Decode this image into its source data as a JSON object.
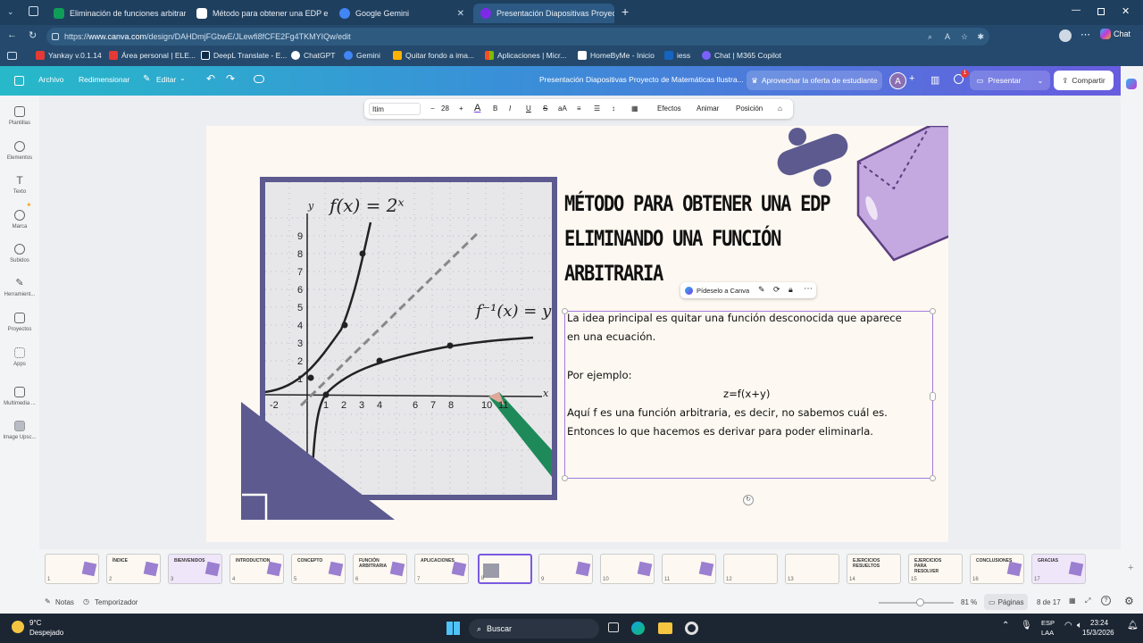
{
  "browser": {
    "tabs": [
      {
        "title": "Eliminación de funciones arbitraria",
        "color": "#0f9d58"
      },
      {
        "title": "Método para obtener una EDP eli",
        "color": "#ffffff"
      },
      {
        "title": "Google Gemini",
        "color": "#4285f4"
      },
      {
        "title": "Presentación Diapositivas Proyect",
        "color": "#7d2ae8"
      }
    ],
    "url_prefix": "https://",
    "url_host": "www.canva.com",
    "url_path": "/design/DAHDmjFGbwE/JLewfi8fCFE2Fg4TKMYIQw/edit",
    "profile_label": "Chat",
    "bookmarks": [
      {
        "label": "Yankay v.0.1.14",
        "color": "#e53935"
      },
      {
        "label": "Área personal | ELE...",
        "color": "#e53935"
      },
      {
        "label": "DeepL Translate - E...",
        "color": "#0f2b46"
      },
      {
        "label": "ChatGPT",
        "color": "#ffffff"
      },
      {
        "label": "Gemini",
        "color": "#4285f4"
      },
      {
        "label": "Quitar fondo a ima...",
        "color": "#ffb300"
      },
      {
        "label": "Aplicaciones | Micr...",
        "color": "#f25022"
      },
      {
        "label": "HomeByMe - Inicio",
        "color": "#ffffff"
      },
      {
        "label": "iess",
        "color": "#1565c0"
      },
      {
        "label": "Chat | M365 Copilot",
        "color": "#7b61ff"
      }
    ]
  },
  "canva": {
    "menu": {
      "file": "Archivo",
      "resize": "Redimensionar",
      "edit": "Editar"
    },
    "doc_title": "Presentación Diapositivas Proyecto de Matemáticas Ilustra...",
    "offer": "Aprovechar la oferta de estudiante",
    "avatar": "A",
    "notif_count": "1",
    "present": "Presentar",
    "share": "Compartir",
    "sidebar": [
      {
        "label": "Plantillas"
      },
      {
        "label": "Elementos"
      },
      {
        "label": "Texto"
      },
      {
        "label": "Marca"
      },
      {
        "label": "Subidos"
      },
      {
        "label": "Herramient..."
      },
      {
        "label": "Proyectos"
      },
      {
        "label": "Apps"
      },
      {
        "label": "Multimedia ..."
      },
      {
        "label": "Image Upsc..."
      }
    ],
    "toolbar": {
      "font": "Itim",
      "minus": "−",
      "font_size": "28",
      "plus": "+",
      "color_glyph": "A",
      "bold": "B",
      "italic": "I",
      "underline": "U",
      "strike": "S",
      "case": "aA",
      "effects": "Efectos",
      "animate": "Animar",
      "position": "Posición"
    },
    "slide": {
      "title_lines": [
        "MÉTODO PARA OBTENER UNA EDP",
        "ELIMINANDO UNA FUNCIÓN",
        "ARBITRARIA"
      ],
      "body": {
        "p1a": "La idea principal es quitar una función desconocida que aparece",
        "p1b": "en una ecuación.",
        "p2": "Por ejemplo:",
        "formula": "z=f(x+y)",
        "p3a": "Aquí f es una función arbitraria, es decir, no sabemos cuál es.",
        "p3b": "Entonces lo que hacemos es derivar para poder eliminarla."
      },
      "graph": {
        "f_label": "f(x) = 2ˣ",
        "finv_label": "f⁻¹(x) = y",
        "y_axis": "y",
        "x_axis": "x",
        "y_ticks": [
          "9",
          "8",
          "7",
          "6",
          "5",
          "4",
          "3",
          "2",
          "1"
        ],
        "x_ticks": [
          "-2",
          "1",
          "2",
          "3",
          "4",
          "6",
          "7",
          "8",
          "10",
          "11"
        ]
      },
      "magic_popup": "Pídeselo a Canva"
    },
    "thumbnails": [
      {
        "n": "1",
        "t": ""
      },
      {
        "n": "2",
        "t": "ÍNDICE"
      },
      {
        "n": "3",
        "t": "BIENVENIDOS"
      },
      {
        "n": "4",
        "t": "INTRODUCTION"
      },
      {
        "n": "5",
        "t": "CONCEPTO"
      },
      {
        "n": "6",
        "t": "FUNCIÓN ARBITRARIA"
      },
      {
        "n": "7",
        "t": "APLICACIONES"
      },
      {
        "n": "8",
        "t": ""
      },
      {
        "n": "9",
        "t": ""
      },
      {
        "n": "10",
        "t": ""
      },
      {
        "n": "11",
        "t": ""
      },
      {
        "n": "12",
        "t": ""
      },
      {
        "n": "13",
        "t": ""
      },
      {
        "n": "14",
        "t": "EJERCICIOS RESUELTOS"
      },
      {
        "n": "15",
        "t": "EJERCICIOS PARA RESOLVER"
      },
      {
        "n": "16",
        "t": "CONCLUSIONES"
      },
      {
        "n": "17",
        "t": "GRACIAS"
      }
    ],
    "footer": {
      "notes": "Notas",
      "timer": "Temporizador",
      "zoom": "81 %",
      "pages": "Páginas",
      "page_count": "8 de 17"
    }
  },
  "taskbar": {
    "temp": "9°C",
    "weather": "Despejado",
    "search": "Buscar",
    "lang1": "ESP",
    "lang2": "LAA",
    "time": "23:24",
    "date": "15/3/2026"
  },
  "colors": {
    "slide_bg": "#fdf8f1",
    "purple_dark": "#5c5a8f",
    "purple_light": "#c4a8e0",
    "selection": "#a47be0"
  }
}
